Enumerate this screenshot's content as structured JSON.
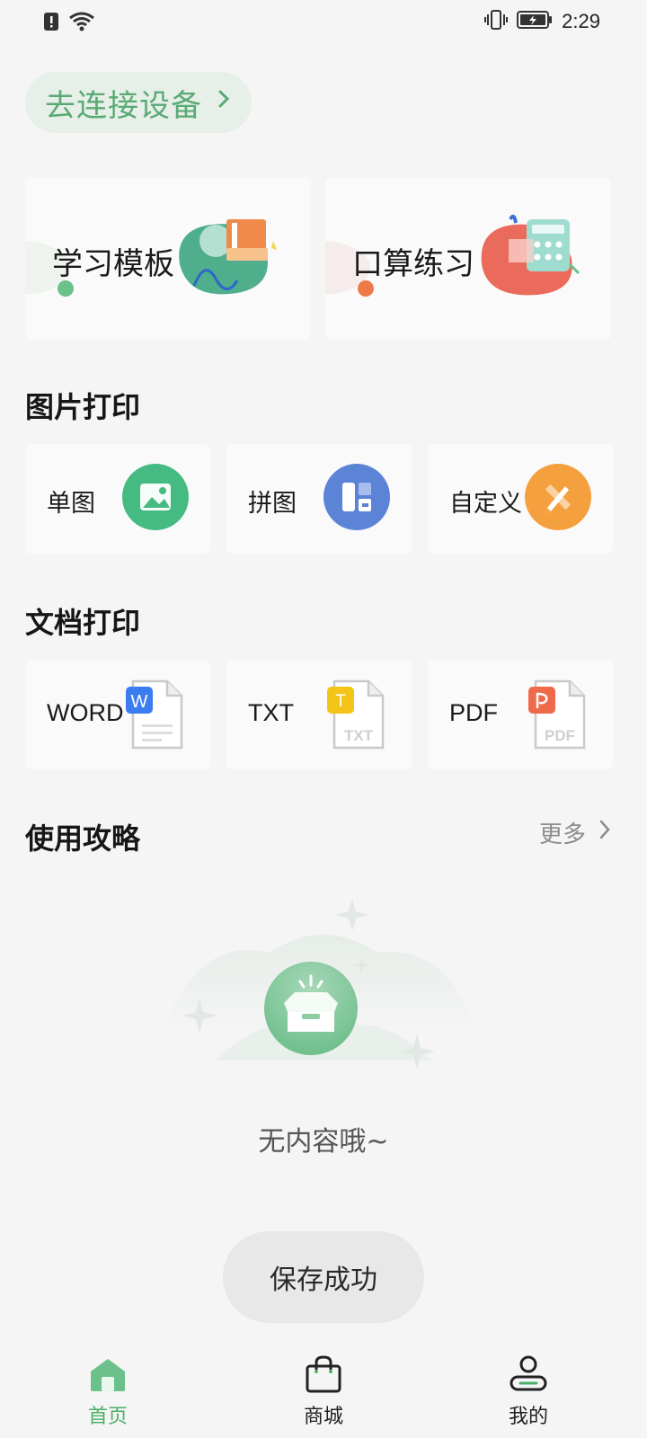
{
  "status_bar": {
    "time": "2:29",
    "icons": [
      "alert-icon",
      "wifi-icon",
      "vibrate-icon",
      "battery-charging-icon"
    ]
  },
  "connect": {
    "label": "去连接设备"
  },
  "feature_cards": [
    {
      "label": "学习模板",
      "accent": "#5bb48a",
      "dot": "#6cc08a"
    },
    {
      "label": "口算练习",
      "accent": "#e8675a",
      "dot": "#ee7a4a"
    }
  ],
  "photo_print": {
    "title": "图片打印",
    "items": [
      {
        "label": "单图",
        "icon": "image-icon",
        "color": "#45bb82"
      },
      {
        "label": "拼图",
        "icon": "collage-icon",
        "color": "#5b83d6"
      },
      {
        "label": "自定义",
        "icon": "pencil-ruler-icon",
        "color": "#f5a03f"
      }
    ]
  },
  "doc_print": {
    "title": "文档打印",
    "items": [
      {
        "label": "WORD",
        "badge": "W",
        "icon": "word-doc-icon",
        "color": "#3b7cf0"
      },
      {
        "label": "TXT",
        "badge": "T",
        "ext": "TXT",
        "icon": "txt-doc-icon",
        "color": "#f5c419"
      },
      {
        "label": "PDF",
        "badge": "",
        "ext": "PDF",
        "icon": "pdf-doc-icon",
        "color": "#ef6a4b"
      }
    ]
  },
  "guide": {
    "title": "使用攻略",
    "more": "更多"
  },
  "empty_state": {
    "text": "无内容哦~"
  },
  "toast": {
    "text": "保存成功"
  },
  "bottom_nav": [
    {
      "label": "首页",
      "icon": "home-icon",
      "active": true
    },
    {
      "label": "商城",
      "icon": "shopping-bag-icon",
      "active": false
    },
    {
      "label": "我的",
      "icon": "profile-icon",
      "active": false
    }
  ]
}
